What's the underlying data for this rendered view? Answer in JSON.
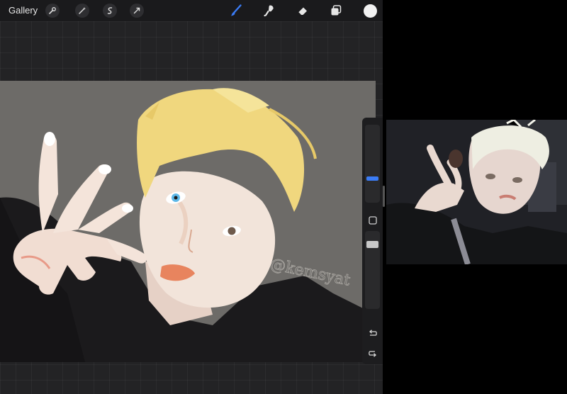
{
  "toolbar": {
    "gallery_label": "Gallery",
    "left_tools": [
      {
        "name": "wrench-icon"
      },
      {
        "name": "magic-wand-icon"
      },
      {
        "name": "selection-icon"
      },
      {
        "name": "transform-arrow-icon"
      }
    ],
    "right_tools": [
      {
        "name": "brush-icon",
        "active": true
      },
      {
        "name": "smudge-icon"
      },
      {
        "name": "eraser-icon"
      },
      {
        "name": "layers-icon"
      }
    ],
    "current_color": "#f2f2f2",
    "accent_color": "#3b7cf5"
  },
  "canvas": {
    "signature": "@kemsyat"
  },
  "sidebar": {
    "brush_size_control": "slider",
    "opacity_control": "slider",
    "modify_button": "square-icon",
    "undo": "undo-icon",
    "redo": "redo-icon"
  },
  "reference": {
    "type": "photo"
  }
}
